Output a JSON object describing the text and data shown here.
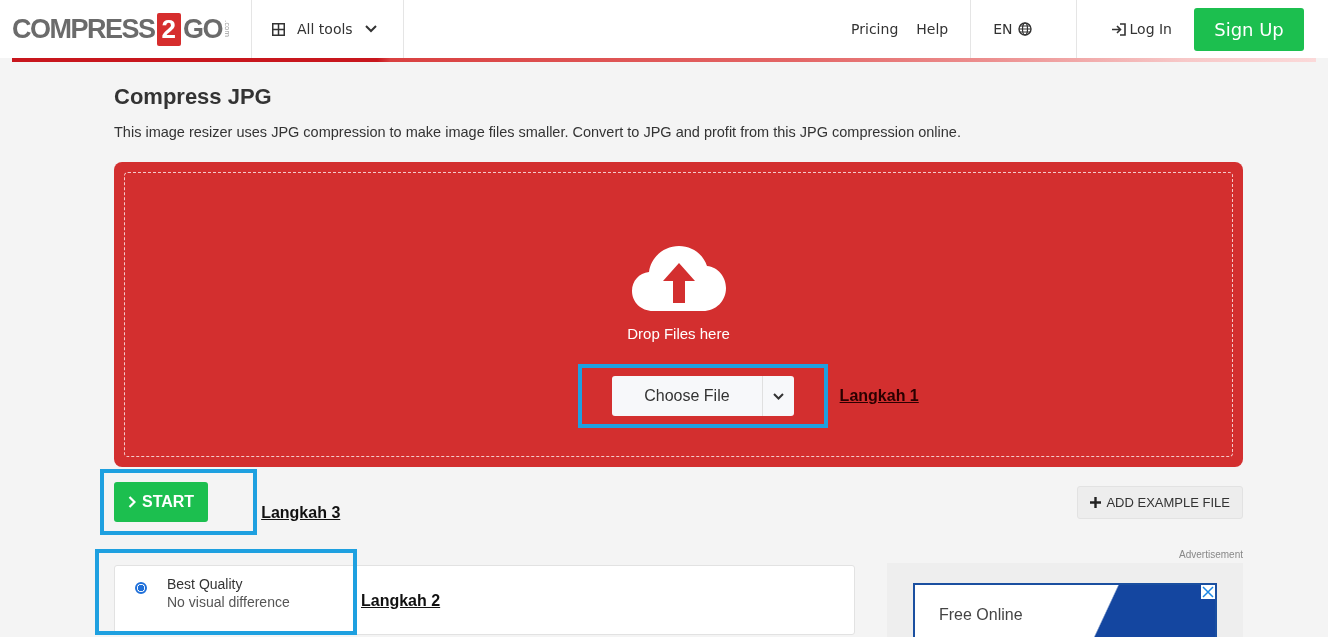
{
  "header": {
    "logo": {
      "word_1": "COMPRESS",
      "badge": "2",
      "word_2": "GO",
      "suffix": ".com"
    },
    "all_tools": "All tools",
    "links": [
      "Pricing",
      "Help"
    ],
    "language": "EN",
    "login": "Log In",
    "signup": "Sign Up"
  },
  "title": "Compress JPG",
  "description": "This image resizer uses JPG compression to make image files smaller. Convert to JPG and profit from this JPG compression online.",
  "dropzone": {
    "text": "Drop Files here",
    "button": "Choose File",
    "annotation": "Langkah 1"
  },
  "start": {
    "button": "START",
    "annotation": "Langkah 3"
  },
  "add_example": "ADD EXAMPLE FILE",
  "options": [
    {
      "title": "Best Quality",
      "subtitle": "No visual difference",
      "selected": true
    }
  ],
  "options_annotation": "Langkah 2",
  "ad": {
    "label": "Advertisement",
    "headline": "Free Online"
  }
}
